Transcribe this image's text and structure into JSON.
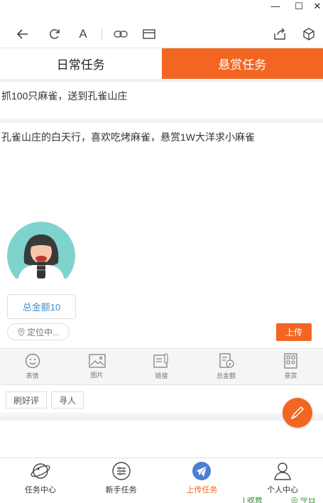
{
  "window": {
    "minimize_glyph": "—",
    "maximize_glyph": "☐",
    "close_glyph": "✕"
  },
  "toolbar": {
    "text_size_glyph": "A"
  },
  "tabs": [
    {
      "label": "日常任务",
      "active": false
    },
    {
      "label": "悬赏任务",
      "active": true
    }
  ],
  "task": {
    "title_value": "抓100只麻雀，送到孔雀山庄",
    "content_value": "孔雀山庄的白天行，喜欢吃烤麻雀，悬赏1W大洋求小麻雀",
    "amount_label": "总金额10",
    "location_label": "定位中...",
    "upload_label": "上传"
  },
  "tools": [
    {
      "icon": "emoji-icon",
      "label": "表情"
    },
    {
      "icon": "image-icon",
      "label": "图片"
    },
    {
      "icon": "link-icon",
      "label": "链接"
    },
    {
      "icon": "amount-icon",
      "label": "总金额"
    },
    {
      "icon": "reward-icon",
      "label": "悬赏"
    }
  ],
  "tags": [
    "刷好评",
    "寻人"
  ],
  "nav": [
    {
      "icon": "planet-icon",
      "label": "任务中心",
      "active": false
    },
    {
      "icon": "menu-list-icon",
      "label": "新手任务",
      "active": false
    },
    {
      "icon": "paper-plane-icon",
      "label": "上传任务",
      "active": true
    },
    {
      "icon": "person-icon",
      "label": "个人中心",
      "active": false
    }
  ],
  "tray": {
    "item1": "| 收费",
    "item2": "◎ 今日"
  },
  "colors": {
    "accent": "#f26622",
    "link_blue": "#3b8fd3",
    "avatar_bg": "#7fd3cd"
  }
}
